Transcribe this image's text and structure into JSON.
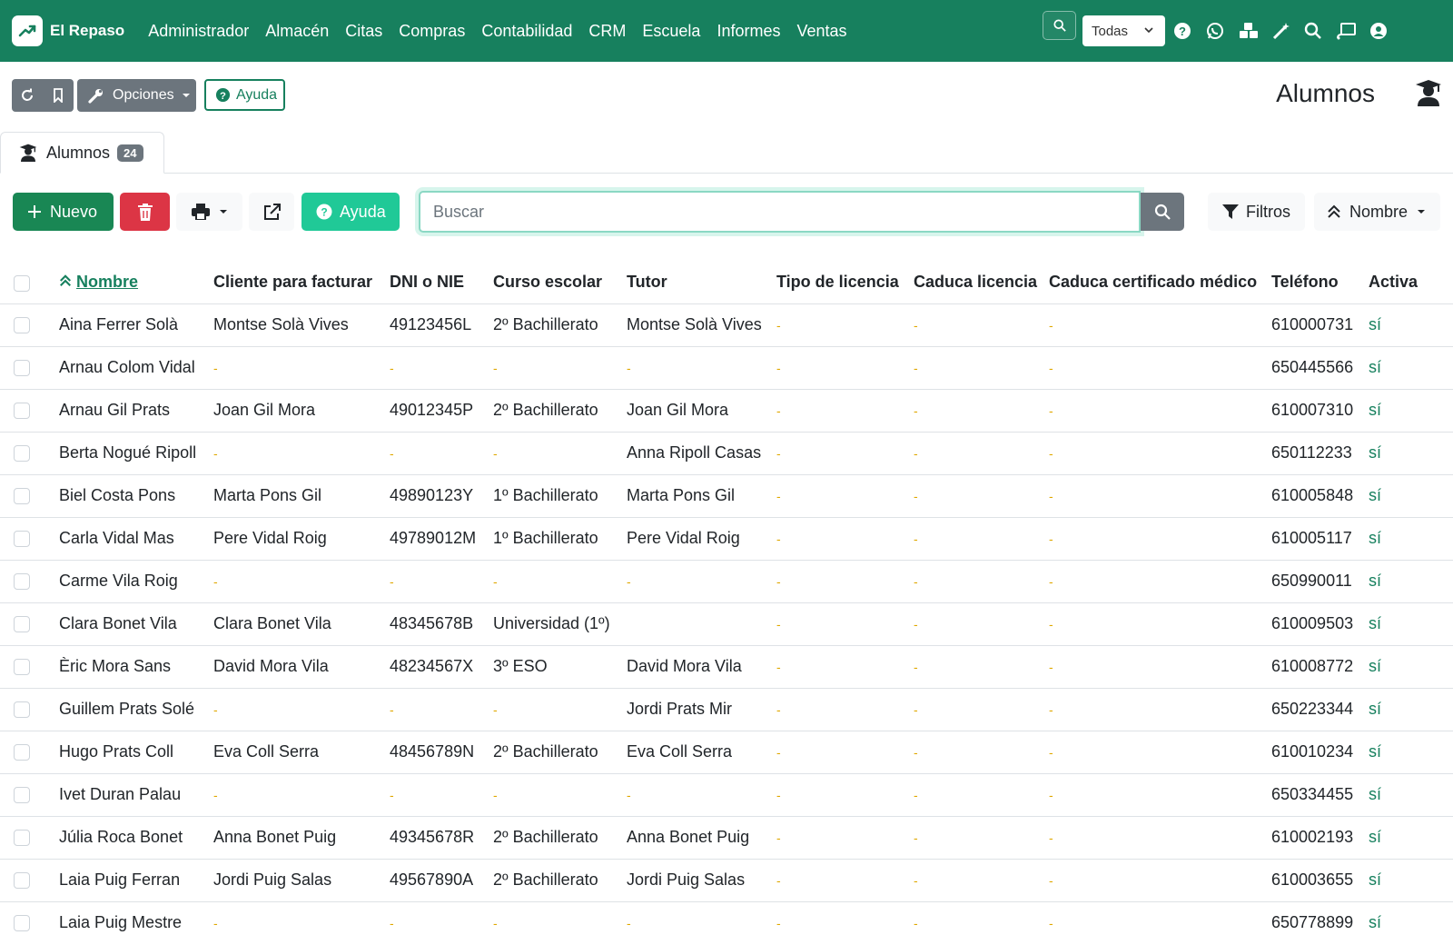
{
  "brand": {
    "name": "El Repaso"
  },
  "menu": [
    "Administrador",
    "Almacén",
    "Citas",
    "Compras",
    "Contabilidad",
    "CRM",
    "Escuela",
    "Informes",
    "Ventas"
  ],
  "nav": {
    "scope_select": "Todas",
    "icons": [
      "help-icon",
      "whatsapp-icon",
      "modules-icon",
      "magic-wand-icon",
      "search-icon",
      "cast-icon",
      "user-icon"
    ]
  },
  "toolbar": {
    "options_label": "Opciones",
    "help_label": "Ayuda"
  },
  "page": {
    "title": "Alumnos"
  },
  "tab": {
    "label": "Alumnos",
    "count": "24"
  },
  "actions": {
    "new_label": "Nuevo",
    "help_label": "Ayuda",
    "search_placeholder": "Buscar",
    "filters_label": "Filtros",
    "sort_label": "Nombre"
  },
  "colors": {
    "primary": "#17805e",
    "danger": "#dc3545",
    "info": "#20c997",
    "muted": "#6c757d",
    "dash": "#e0a800"
  },
  "table": {
    "headers": [
      "Nombre",
      "Cliente para facturar",
      "DNI o NIE",
      "Curso escolar",
      "Tutor",
      "Tipo de licencia",
      "Caduca licencia",
      "Caduca certificado médico",
      "Teléfono",
      "Activa"
    ],
    "rows": [
      {
        "nombre": "Aina Ferrer Solà",
        "cliente": "Montse Solà Vives",
        "dni": "49123456L",
        "curso": "2º Bachillerato",
        "tutor": "Montse Solà Vives",
        "tipo": "-",
        "cad_lic": "-",
        "cad_cert": "-",
        "tel": "610000731",
        "activa": "sí"
      },
      {
        "nombre": "Arnau Colom Vidal",
        "cliente": "-",
        "dni": "-",
        "curso": "-",
        "tutor": "-",
        "tipo": "-",
        "cad_lic": "-",
        "cad_cert": "-",
        "tel": "650445566",
        "activa": "sí"
      },
      {
        "nombre": "Arnau Gil Prats",
        "cliente": "Joan Gil Mora",
        "dni": "49012345P",
        "curso": "2º Bachillerato",
        "tutor": "Joan Gil Mora",
        "tipo": "-",
        "cad_lic": "-",
        "cad_cert": "-",
        "tel": "610007310",
        "activa": "sí"
      },
      {
        "nombre": "Berta Nogué Ripoll",
        "cliente": "-",
        "dni": "-",
        "curso": "-",
        "tutor": "Anna Ripoll Casas",
        "tipo": "-",
        "cad_lic": "-",
        "cad_cert": "-",
        "tel": "650112233",
        "activa": "sí"
      },
      {
        "nombre": "Biel Costa Pons",
        "cliente": "Marta Pons Gil",
        "dni": "49890123Y",
        "curso": "1º Bachillerato",
        "tutor": "Marta Pons Gil",
        "tipo": "-",
        "cad_lic": "-",
        "cad_cert": "-",
        "tel": "610005848",
        "activa": "sí"
      },
      {
        "nombre": "Carla Vidal Mas",
        "cliente": "Pere Vidal Roig",
        "dni": "49789012M",
        "curso": "1º Bachillerato",
        "tutor": "Pere Vidal Roig",
        "tipo": "-",
        "cad_lic": "-",
        "cad_cert": "-",
        "tel": "610005117",
        "activa": "sí"
      },
      {
        "nombre": "Carme Vila Roig",
        "cliente": "-",
        "dni": "-",
        "curso": "-",
        "tutor": "-",
        "tipo": "-",
        "cad_lic": "-",
        "cad_cert": "-",
        "tel": "650990011",
        "activa": "sí"
      },
      {
        "nombre": "Clara Bonet Vila",
        "cliente": "Clara Bonet Vila",
        "dni": "48345678B",
        "curso": "Universidad (1º)",
        "tutor": "",
        "tipo": "-",
        "cad_lic": "-",
        "cad_cert": "-",
        "tel": "610009503",
        "activa": "sí"
      },
      {
        "nombre": "Èric Mora Sans",
        "cliente": "David Mora Vila",
        "dni": "48234567X",
        "curso": "3º ESO",
        "tutor": "David Mora Vila",
        "tipo": "-",
        "cad_lic": "-",
        "cad_cert": "-",
        "tel": "610008772",
        "activa": "sí"
      },
      {
        "nombre": "Guillem Prats Solé",
        "cliente": "-",
        "dni": "-",
        "curso": "-",
        "tutor": "Jordi Prats Mir",
        "tipo": "-",
        "cad_lic": "-",
        "cad_cert": "-",
        "tel": "650223344",
        "activa": "sí"
      },
      {
        "nombre": "Hugo Prats Coll",
        "cliente": "Eva Coll Serra",
        "dni": "48456789N",
        "curso": "2º Bachillerato",
        "tutor": "Eva Coll Serra",
        "tipo": "-",
        "cad_lic": "-",
        "cad_cert": "-",
        "tel": "610010234",
        "activa": "sí"
      },
      {
        "nombre": "Ivet Duran Palau",
        "cliente": "-",
        "dni": "-",
        "curso": "-",
        "tutor": "-",
        "tipo": "-",
        "cad_lic": "-",
        "cad_cert": "-",
        "tel": "650334455",
        "activa": "sí"
      },
      {
        "nombre": "Júlia Roca Bonet",
        "cliente": "Anna Bonet Puig",
        "dni": "49345678R",
        "curso": "2º Bachillerato",
        "tutor": "Anna Bonet Puig",
        "tipo": "-",
        "cad_lic": "-",
        "cad_cert": "-",
        "tel": "610002193",
        "activa": "sí"
      },
      {
        "nombre": "Laia Puig Ferran",
        "cliente": "Jordi Puig Salas",
        "dni": "49567890A",
        "curso": "2º Bachillerato",
        "tutor": "Jordi Puig Salas",
        "tipo": "-",
        "cad_lic": "-",
        "cad_cert": "-",
        "tel": "610003655",
        "activa": "sí"
      },
      {
        "nombre": "Laia Puig Mestre",
        "cliente": "-",
        "dni": "-",
        "curso": "-",
        "tutor": "-",
        "tipo": "-",
        "cad_lic": "-",
        "cad_cert": "-",
        "tel": "650778899",
        "activa": "sí"
      }
    ]
  }
}
